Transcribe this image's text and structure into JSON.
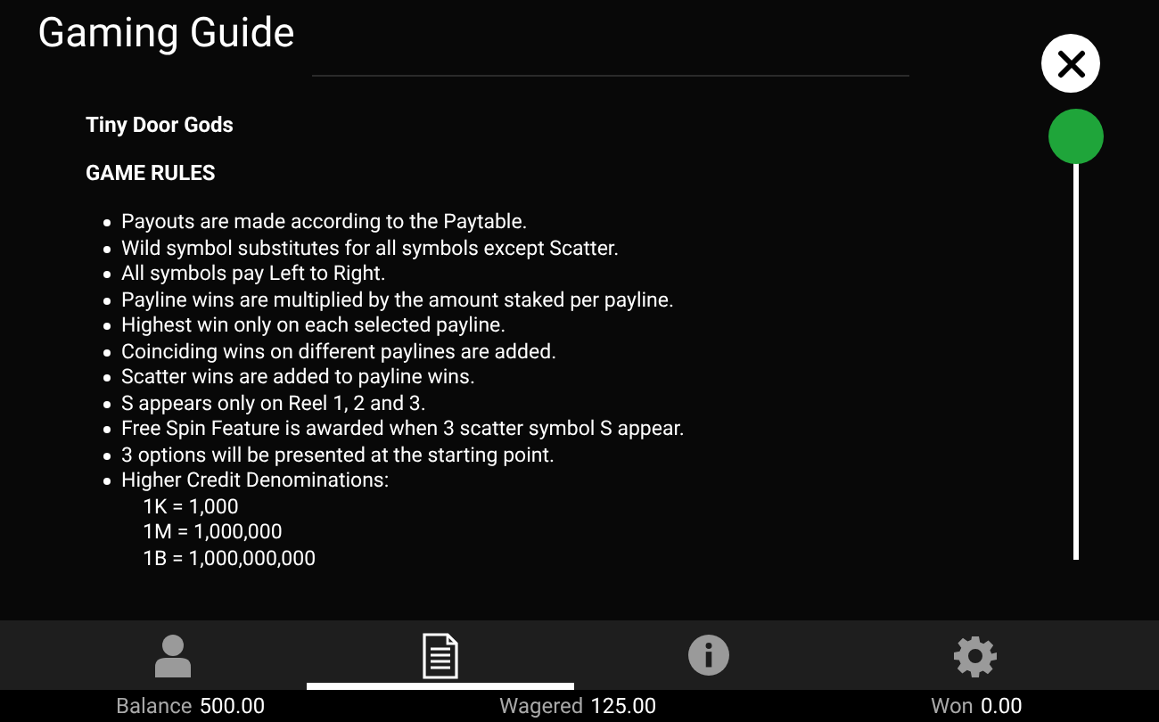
{
  "window": {
    "title": "Gaming Guide"
  },
  "content": {
    "game_name": "Tiny Door Gods",
    "section_heading": "GAME RULES",
    "rules": [
      {
        "text": "Payouts are made according to the Paytable."
      },
      {
        "text": "Wild symbol substitutes for all symbols except Scatter."
      },
      {
        "text": "All symbols pay Left to Right."
      },
      {
        "text": "Payline wins are multiplied by the amount staked per payline."
      },
      {
        "text": "Highest win only on each selected payline."
      },
      {
        "text": "Coinciding wins on different paylines are added."
      },
      {
        "text": "Scatter wins are added to payline wins."
      },
      {
        "text": "S appears only on Reel 1, 2 and 3."
      },
      {
        "text": "Free Spin Feature is awarded when 3 scatter symbol S appear."
      },
      {
        "text": "3 options will be presented at the starting point."
      },
      {
        "text": "Higher Credit Denominations:",
        "sub_lines": [
          "1K = 1,000",
          "1M = 1,000,000",
          "1B = 1,000,000,000"
        ]
      }
    ]
  },
  "tabs": [
    {
      "kind": "account",
      "selected": false
    },
    {
      "kind": "guide",
      "selected": true
    },
    {
      "kind": "info",
      "selected": false
    },
    {
      "kind": "settings",
      "selected": false
    }
  ],
  "status_bar": [
    {
      "label": "Balance",
      "value": "500.00"
    },
    {
      "label": "Wagered",
      "value": "125.00"
    },
    {
      "label": "Won",
      "value": "0.00"
    }
  ]
}
